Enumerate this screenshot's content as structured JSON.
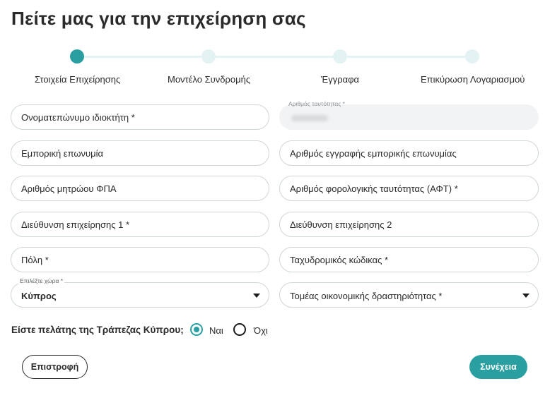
{
  "page_title": "Πείτε μας για την επιχείρηση σας",
  "stepper": {
    "steps": [
      {
        "label": "Στοιχεία Επιχείρησης",
        "active": true
      },
      {
        "label": "Μοντέλο Συνδρομής",
        "active": false
      },
      {
        "label": "Έγγραφα",
        "active": false
      },
      {
        "label": "Επικύρωση Λογαριασμού",
        "active": false
      }
    ]
  },
  "form": {
    "owner_name_placeholder": "Ονοματεπώνυμο ιδιοκτήτη *",
    "id_number_label": "Αριθμός ταυτότητας *",
    "trade_name_placeholder": "Εμπορική επωνυμία",
    "trade_reg_number_placeholder": "Αριθμός εγγραφής εμπορικής επωνυμίας",
    "vat_number_placeholder": "Αριθμός μητρώου ΦΠΑ",
    "tax_id_placeholder": "Αριθμός φορολογικής ταυτότητας (ΑΦΤ) *",
    "address1_placeholder": "Διεύθυνση επιχείρησης 1 *",
    "address2_placeholder": "Διεύθυνση επιχείρησης 2",
    "city_placeholder": "Πόλη *",
    "postal_code_placeholder": "Ταχυδρομικός κώδικας *",
    "country_label": "Επιλέξτε χώρα *",
    "country_value": "Κύπρος",
    "sector_placeholder": "Τομέας οικονομικής δραστηριότητας *"
  },
  "customer_question": {
    "text": "Είστε πελάτης της Τράπεζας Κύπρου;",
    "yes_label": "Ναι",
    "no_label": "Όχι",
    "selected": "yes"
  },
  "buttons": {
    "back_label": "Επιστροφή",
    "continue_label": "Συνέχεια"
  },
  "colors": {
    "accent": "#2a9fa1",
    "stepper_inactive": "#e3f3f3",
    "field_border": "#cfd6d8"
  }
}
